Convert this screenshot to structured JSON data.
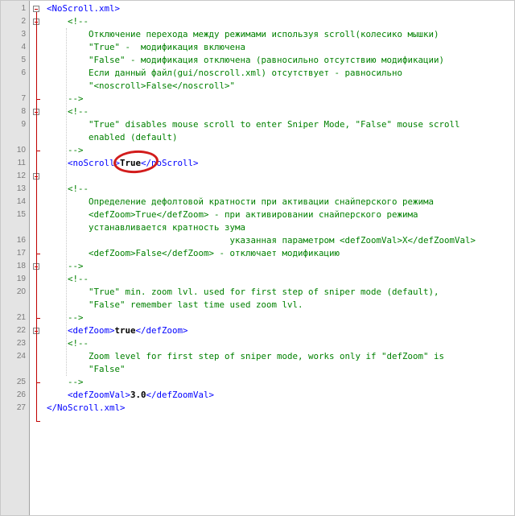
{
  "editor": {
    "language": "xml",
    "colors": {
      "tag": "#0000ff",
      "comment": "#008000",
      "text": "#000000",
      "gutter_bg": "#e4e4e4",
      "fold_marker": "#c00000",
      "highlight_circle": "#d21c1c"
    },
    "lines": [
      {
        "n": "1",
        "segments": [
          {
            "t": "tag",
            "v": "<NoScroll.xml>"
          }
        ]
      },
      {
        "n": "2",
        "segments": [
          {
            "t": "cmt",
            "v": "    <!--"
          }
        ]
      },
      {
        "n": "3",
        "segments": [
          {
            "t": "cmt",
            "v": "        Отключение перехода между режимами используя scroll(колесико мышки)"
          }
        ]
      },
      {
        "n": "4",
        "segments": [
          {
            "t": "cmt",
            "v": "        \"True\" -  модификация включена"
          }
        ]
      },
      {
        "n": "5",
        "segments": [
          {
            "t": "cmt",
            "v": "        \"False\" - модификация отключена (равносильно отсутствию модификации)"
          }
        ]
      },
      {
        "n": "6",
        "segments": [
          {
            "t": "cmt",
            "v": "        Если данный файл(gui/noscroll.xml) отсутствует - равносильно"
          }
        ]
      },
      {
        "n": "",
        "segments": [
          {
            "t": "cmt",
            "v": "        \"<noscroll>False</noscroll>\""
          }
        ]
      },
      {
        "n": "7",
        "segments": [
          {
            "t": "cmt",
            "v": "    -->"
          }
        ]
      },
      {
        "n": "8",
        "segments": [
          {
            "t": "cmt",
            "v": "    <!--"
          }
        ]
      },
      {
        "n": "9",
        "segments": [
          {
            "t": "cmt",
            "v": "        \"True\" disables mouse scroll to enter Sniper Mode, \"False\" mouse scroll"
          }
        ]
      },
      {
        "n": "",
        "segments": [
          {
            "t": "cmt",
            "v": "        enabled (default)"
          }
        ]
      },
      {
        "n": "10",
        "segments": [
          {
            "t": "cmt",
            "v": "    -->"
          }
        ]
      },
      {
        "n": "11",
        "segments": [
          {
            "t": "tag",
            "v": "    <noScroll>"
          },
          {
            "t": "txt",
            "v": "True"
          },
          {
            "t": "tag",
            "v": "</noScroll>"
          }
        ]
      },
      {
        "n": "12",
        "segments": []
      },
      {
        "n": "13",
        "segments": [
          {
            "t": "cmt",
            "v": "    <!--"
          }
        ]
      },
      {
        "n": "14",
        "segments": [
          {
            "t": "cmt",
            "v": "        Определение дефолтовой кратности при активации снайперского режима"
          }
        ]
      },
      {
        "n": "15",
        "segments": [
          {
            "t": "cmt",
            "v": "        <defZoom>True</defZoom> - при активировании снайперского режима"
          }
        ]
      },
      {
        "n": "",
        "segments": [
          {
            "t": "cmt",
            "v": "        устанавливается кратность зума"
          }
        ]
      },
      {
        "n": "16",
        "segments": [
          {
            "t": "cmt",
            "v": "                                   указанная параметром <defZoomVal>X</defZoomVal>"
          }
        ]
      },
      {
        "n": "17",
        "segments": [
          {
            "t": "cmt",
            "v": "        <defZoom>False</defZoom> - отключает модификацию"
          }
        ]
      },
      {
        "n": "18",
        "segments": [
          {
            "t": "cmt",
            "v": "    -->"
          }
        ]
      },
      {
        "n": "19",
        "segments": [
          {
            "t": "cmt",
            "v": "    <!--"
          }
        ]
      },
      {
        "n": "20",
        "segments": [
          {
            "t": "cmt",
            "v": "        \"True\" min. zoom lvl. used for first step of sniper mode (default),"
          }
        ]
      },
      {
        "n": "",
        "segments": [
          {
            "t": "cmt",
            "v": "        \"False\" remember last time used zoom lvl."
          }
        ]
      },
      {
        "n": "21",
        "segments": [
          {
            "t": "cmt",
            "v": "    -->"
          }
        ]
      },
      {
        "n": "22",
        "segments": [
          {
            "t": "tag",
            "v": "    <defZoom>"
          },
          {
            "t": "txt",
            "v": "true"
          },
          {
            "t": "tag",
            "v": "</defZoom>"
          }
        ]
      },
      {
        "n": "23",
        "segments": [
          {
            "t": "cmt",
            "v": "    <!--"
          }
        ]
      },
      {
        "n": "24",
        "segments": [
          {
            "t": "cmt",
            "v": "        Zoom level for first step of sniper mode, works only if \"defZoom\" is"
          }
        ]
      },
      {
        "n": "",
        "segments": [
          {
            "t": "cmt",
            "v": "        \"False\""
          }
        ]
      },
      {
        "n": "25",
        "segments": [
          {
            "t": "cmt",
            "v": "    -->"
          }
        ]
      },
      {
        "n": "26",
        "segments": [
          {
            "t": "tag",
            "v": "    <defZoomVal>"
          },
          {
            "t": "txt",
            "v": "3.0"
          },
          {
            "t": "tag",
            "v": "</defZoomVal>"
          }
        ]
      },
      {
        "n": "27",
        "segments": [
          {
            "t": "tag",
            "v": "</NoScroll.xml>"
          }
        ]
      }
    ]
  }
}
